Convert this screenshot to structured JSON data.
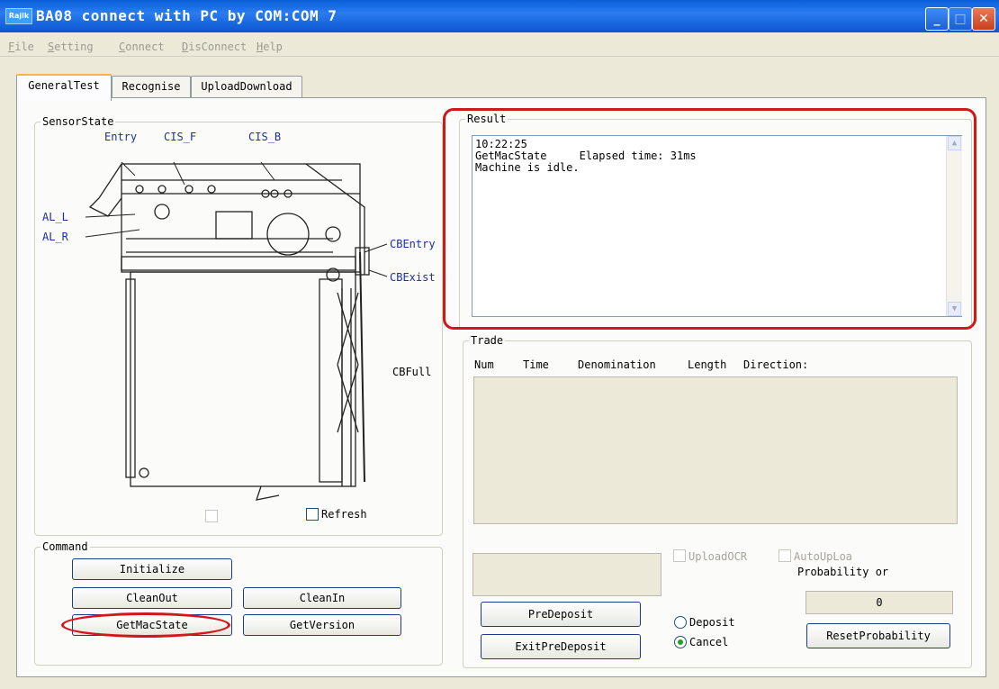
{
  "window": {
    "title": "BA08 connect with PC by COM:COM 7",
    "app_icon_text": "Rajlk"
  },
  "menu": [
    {
      "label": "File",
      "key": "F",
      "rest": "ile"
    },
    {
      "label": "Setting",
      "key": "S",
      "rest": "etting"
    },
    {
      "label": "Connect",
      "key": "C",
      "rest": "onnect"
    },
    {
      "label": "DisConnect",
      "key": "D",
      "rest": "isConnect"
    },
    {
      "label": "Help",
      "key": "H",
      "rest": "elp"
    }
  ],
  "tabs": [
    "GeneralTest",
    "Recognise",
    "UploadDownload"
  ],
  "sensor": {
    "group_label": "SensorState",
    "labels": {
      "entry": "Entry",
      "cis_f": "CIS_F",
      "cis_b": "CIS_B",
      "al_l": "AL_L",
      "al_r": "AL_R",
      "cb_entry": "CBEntry",
      "cb_exist": "CBExist",
      "cb_full": "CBFull"
    },
    "refresh_label": "Refresh"
  },
  "command": {
    "group_label": "Command",
    "buttons": {
      "initialize": "Initialize",
      "clean_out": "CleanOut",
      "clean_in": "CleanIn",
      "get_mac_state": "GetMacState",
      "get_version": "GetVersion"
    }
  },
  "result": {
    "group_label": "Result",
    "text": "10:22:25\nGetMacState     Elapsed time: 31ms\nMachine is idle."
  },
  "trade": {
    "group_label": "Trade",
    "columns": [
      "Num",
      "Time",
      "Denomination",
      "Length",
      "Direction:"
    ]
  },
  "bottom": {
    "upload_ocr": "UploadOCR",
    "auto_upload": "AutoUpLoa",
    "probability_label": "Probability or",
    "probability_value": "0",
    "pre_deposit": "PreDeposit",
    "exit_pre_deposit": "ExitPreDeposit",
    "radio_deposit": "Deposit",
    "radio_cancel": "Cancel",
    "selected_radio": "Cancel",
    "reset_probability": "ResetProbability"
  }
}
